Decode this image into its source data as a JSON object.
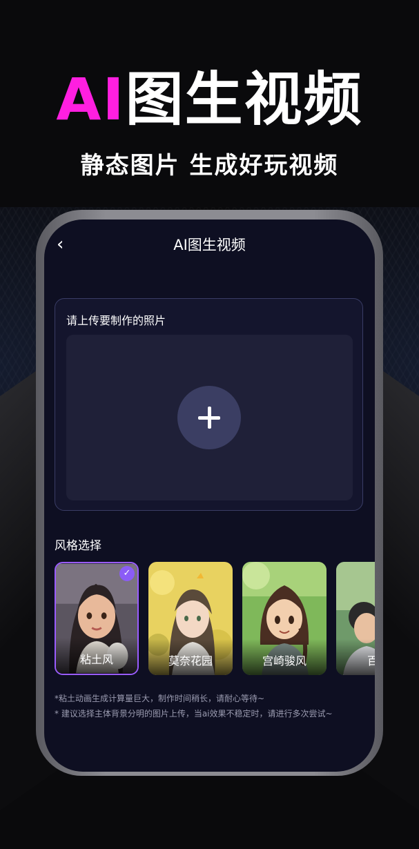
{
  "hero": {
    "title_ai": "AI",
    "title_rest": "图生视频",
    "subtitle": "静态图片 生成好玩视频"
  },
  "app": {
    "nav": {
      "back_icon": "‹",
      "title": "AI图生视频"
    },
    "upload": {
      "label": "请上传要制作的照片",
      "add_icon": "plus-icon"
    },
    "styles": {
      "title": "风格选择",
      "items": [
        {
          "name": "粘土风",
          "selected": true
        },
        {
          "name": "莫奈花园",
          "selected": false
        },
        {
          "name": "宫崎骏风",
          "selected": false
        },
        {
          "name": "百变",
          "selected": false
        }
      ]
    },
    "notes": [
      "*粘土动画生成计算量巨大，制作时间稍长，请耐心等待~",
      "* 建议选择主体背景分明的图片上传，当ai效果不稳定时，请进行多次尝试~"
    ]
  },
  "colors": {
    "accent_magenta": "#ff1fe0",
    "selected_border": "#9a5cff",
    "screen_bg": "#0e0f22"
  }
}
